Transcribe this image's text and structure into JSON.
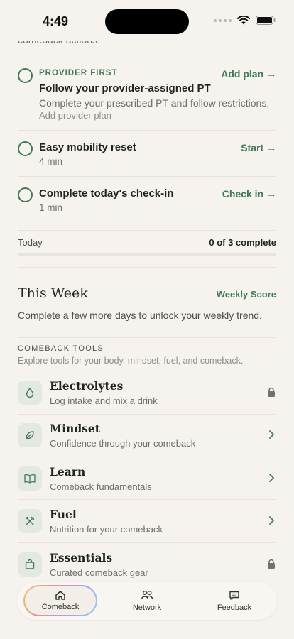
{
  "status_bar": {
    "time": "4:49"
  },
  "intro_partial": "comeback actions.",
  "tasks": [
    {
      "kicker": "PROVIDER FIRST",
      "title": "Follow your provider-assigned PT",
      "description": "Complete your prescribed PT and follow restrictions.",
      "sub": "Add provider plan",
      "action": "Add plan →"
    },
    {
      "title": "Easy mobility reset",
      "sub": "4 min",
      "action": "Start →"
    },
    {
      "title": "Complete today's check-in",
      "sub": "1 min",
      "action": "Check in →"
    }
  ],
  "progress": {
    "label": "Today",
    "count": "0 of 3 complete",
    "completed": 0,
    "total": 3
  },
  "this_week": {
    "title": "This Week",
    "link": "Weekly Score",
    "description": "Complete a few more days to unlock your weekly trend."
  },
  "tools": {
    "kicker": "COMEBACK TOOLS",
    "subtitle": "Explore tools for your body, mindset, fuel, and comeback.",
    "items": [
      {
        "name": "Electrolytes",
        "desc": "Log intake and mix a drink",
        "icon": "droplet-icon",
        "trail": "lock-icon"
      },
      {
        "name": "Mindset",
        "desc": "Confidence through your comeback",
        "icon": "leaf-icon",
        "trail": "chevron-right-icon"
      },
      {
        "name": "Learn",
        "desc": "Comeback fundamentals",
        "icon": "book-icon",
        "trail": "chevron-right-icon"
      },
      {
        "name": "Fuel",
        "desc": "Nutrition for your comeback",
        "icon": "utensils-icon",
        "trail": "chevron-right-icon"
      },
      {
        "name": "Essentials",
        "desc": "Curated comeback gear",
        "icon": "bag-icon",
        "trail": "lock-icon"
      }
    ]
  },
  "tabbar": {
    "tabs": [
      {
        "label": "Comeback",
        "icon": "home-icon",
        "active": true
      },
      {
        "label": "Network",
        "icon": "people-icon",
        "active": false
      },
      {
        "label": "Feedback",
        "icon": "message-icon",
        "active": false
      }
    ]
  },
  "colors": {
    "accent": "#3f7a58",
    "background": "#f6f3ee",
    "icon_bg": "#e3e8e2"
  }
}
